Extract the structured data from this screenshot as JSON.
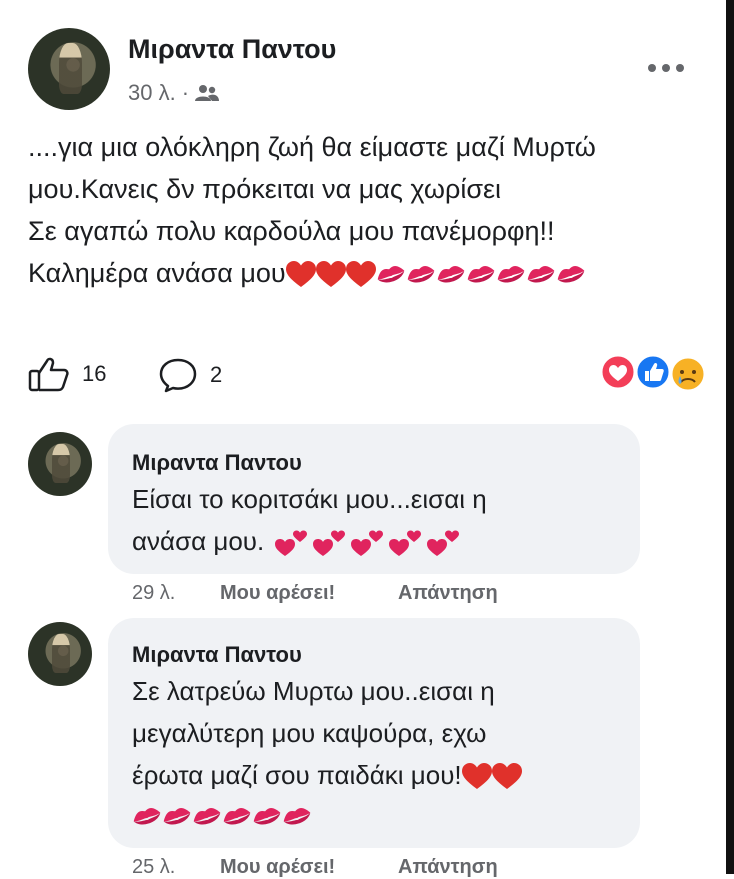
{
  "post": {
    "author": "Μιραντα Παντου",
    "time": "30 λ. ·",
    "lines": [
      "....για μια ολόκληρη ζωή θα είμαστε μαζί Μυρτώ",
      "μου.Κανεις δν πρόκειται να μας χωρίσει",
      "Σε αγαπώ πολυ καρδούλα μου πανέμορφη!!",
      "Καλημέρα ανάσα μου"
    ],
    "likes": "16",
    "comments": "2",
    "icons": {
      "audience": "friends-icon",
      "more": "more-options-icon",
      "like": "thumbs-up-icon",
      "comment": "comment-icon",
      "reactions": [
        "love-reaction-icon",
        "like-reaction-icon",
        "sad-reaction-icon"
      ]
    }
  },
  "comments": [
    {
      "author": "Μιραντα Παντου",
      "lines": [
        "Είσαι το κοριτσάκι μου...εισαι η",
        "ανάσα μου."
      ],
      "time": "29 λ.",
      "like_label": "Μου αρέσει!",
      "reply_label": "Απάντηση"
    },
    {
      "author": "Μιραντα Παντου",
      "lines": [
        "Σε λατρεύω Μυρτω μου..εισαι η",
        "μεγαλύτερη μου καψούρα, εχω",
        "έρωτα μαζί σου παιδάκι μου!"
      ],
      "time": "25 λ.",
      "like_label": "Μου αρέσει!",
      "reply_label": "Απάντηση"
    }
  ],
  "colors": {
    "heart": "#e0312b",
    "kiss": "#e0245e",
    "muted": "#65676b",
    "bubble": "#f0f2f5",
    "like_blue": "#1877f2",
    "love_red": "#f33e58",
    "sad_yellow": "#f7b125"
  }
}
